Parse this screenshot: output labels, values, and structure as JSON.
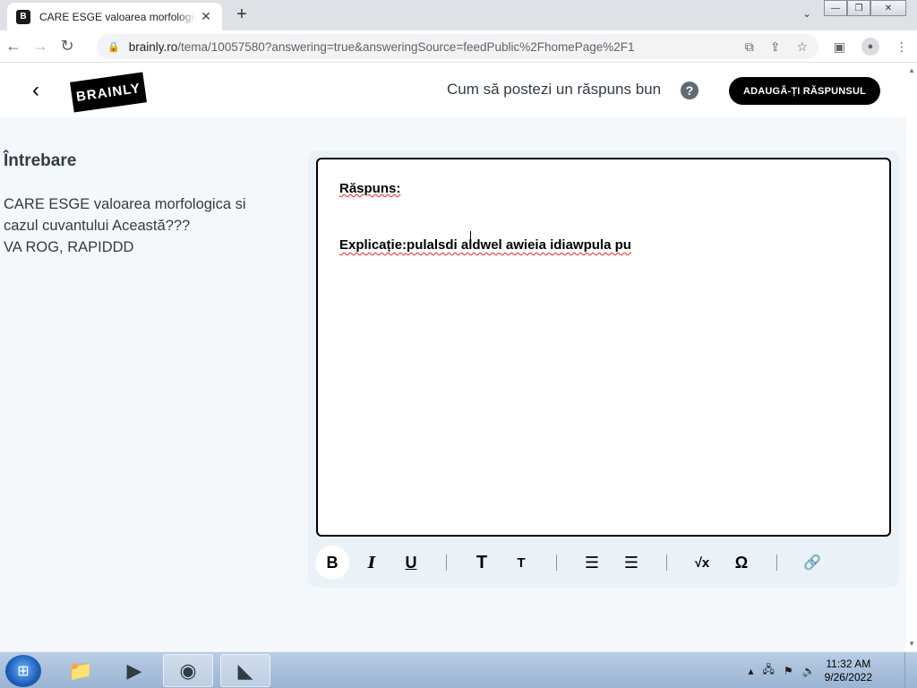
{
  "browser": {
    "tab_title": "CARE ESGE valoarea morfologica",
    "tab_favicon": "B",
    "tab_close": "✕",
    "new_tab": "+",
    "url_host": "brainly.ro",
    "url_rest": "/tema/10057580?answering=true&answeringSource=feedPublic%2FhomePage%2F1"
  },
  "header": {
    "logo": "BRAINLY",
    "howto_text": "Cum să postezi un răspuns bun",
    "help_symbol": "?",
    "add_answer_label": "ADAUGĂ-ȚI RĂSPUNSUL"
  },
  "question": {
    "heading": "Întrebare",
    "lines": [
      "CARE ESGE valoarea morfologica si",
      "cazul cuvantului Această???",
      "VA ROG, RAPIDDD"
    ]
  },
  "editor": {
    "answer_label": "Răspuns:",
    "explanation_label": "Explicație:",
    "explanation_text": "pulalsdi aldwel awieia idiawpula pu"
  },
  "format_bar": {
    "bold": "B",
    "italic": "I",
    "underline": "U",
    "heading_large": "T",
    "heading_small": "T",
    "numbered_list": "☰",
    "bullet_list": "☰",
    "math": "√x",
    "symbol": "Ω",
    "attach": "🔗"
  },
  "taskbar": {
    "time": "11:32 AM",
    "date": "9/26/2022"
  }
}
